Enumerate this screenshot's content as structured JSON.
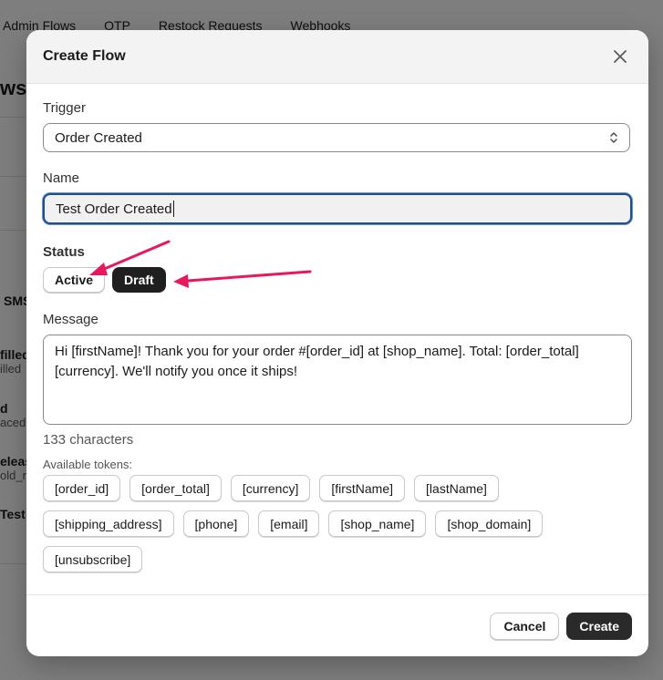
{
  "background": {
    "tabs": [
      "Admin Flows",
      "OTP",
      "Restock Requests",
      "Webhooks"
    ],
    "title_fragment": "ws",
    "rows": [
      {
        "title": "SMS",
        "sub": ""
      },
      {
        "title": "filled",
        "sub": "illed"
      },
      {
        "title": "d",
        "sub": "aced"
      },
      {
        "title": "eleas",
        "sub": "old_r"
      },
      {
        "title": "Test",
        "sub": ""
      }
    ]
  },
  "modal": {
    "title": "Create Flow",
    "trigger": {
      "label": "Trigger",
      "value": "Order Created"
    },
    "name": {
      "label": "Name",
      "value": "Test Order Created"
    },
    "status": {
      "label": "Status",
      "options": [
        "Active",
        "Draft"
      ],
      "selected": "Draft"
    },
    "message": {
      "label": "Message",
      "value": "Hi [firstName]! Thank you for your order #[order_id] at [shop_name]. Total: [order_total] [currency]. We'll notify you once it ships!",
      "char_count": "133 characters"
    },
    "tokens": {
      "label": "Available tokens:",
      "items": [
        "[order_id]",
        "[order_total]",
        "[currency]",
        "[firstName]",
        "[lastName]",
        "[shipping_address]",
        "[phone]",
        "[email]",
        "[shop_name]",
        "[shop_domain]",
        "[unsubscribe]"
      ]
    },
    "footer": {
      "cancel": "Cancel",
      "create": "Create"
    }
  },
  "colors": {
    "annotation_arrow": "#e8185f",
    "primary_button": "#2a2a2a",
    "focus_border": "#1f4f8f"
  },
  "icons": [
    "close-icon",
    "select-chevron-icon"
  ]
}
